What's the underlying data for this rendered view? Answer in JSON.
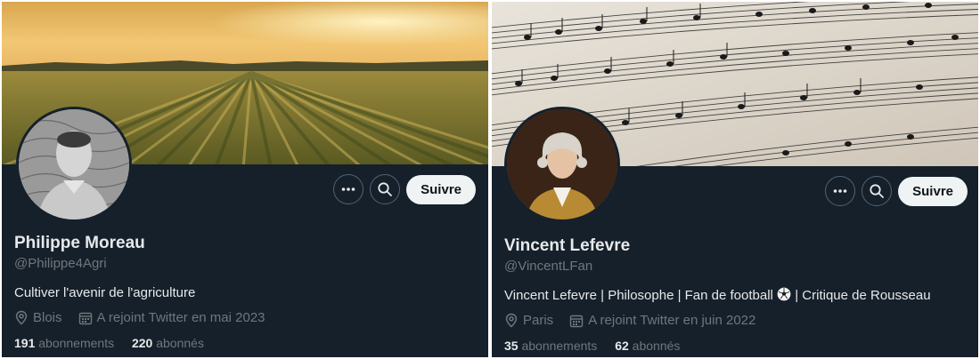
{
  "profiles": [
    {
      "name": "Philippe Moreau",
      "handle": "@Philippe4Agri",
      "bio": "Cultiver l'avenir de l'agriculture",
      "location": "Blois",
      "joined": "A rejoint Twitter en mai 2023",
      "following_count": "191",
      "following_label": "abonnements",
      "followers_count": "220",
      "followers_label": "abonnés",
      "follow_label": "Suivre",
      "banner": "farm-field-sunset"
    },
    {
      "name": "Vincent Lefevre",
      "handle": "@VincentLFan",
      "bio_part1": "Vincent Lefevre  | Philosophe  | Fan de football",
      "bio_part2": "| Critique de Rousseau",
      "location": "Paris",
      "joined": "A rejoint Twitter en juin 2022",
      "following_count": "35",
      "following_label": "abonnements",
      "followers_count": "62",
      "followers_label": "abonnés",
      "follow_label": "Suivre",
      "banner": "sheet-music"
    }
  ],
  "icons": {
    "more": "more-icon",
    "search": "search-icon",
    "location": "location-pin-icon",
    "calendar": "calendar-icon",
    "soccer": "soccer-ball-icon"
  },
  "colors": {
    "background": "#15202b",
    "text": "#e7e9ea",
    "muted": "#71767b",
    "button": "#eff3f4"
  }
}
